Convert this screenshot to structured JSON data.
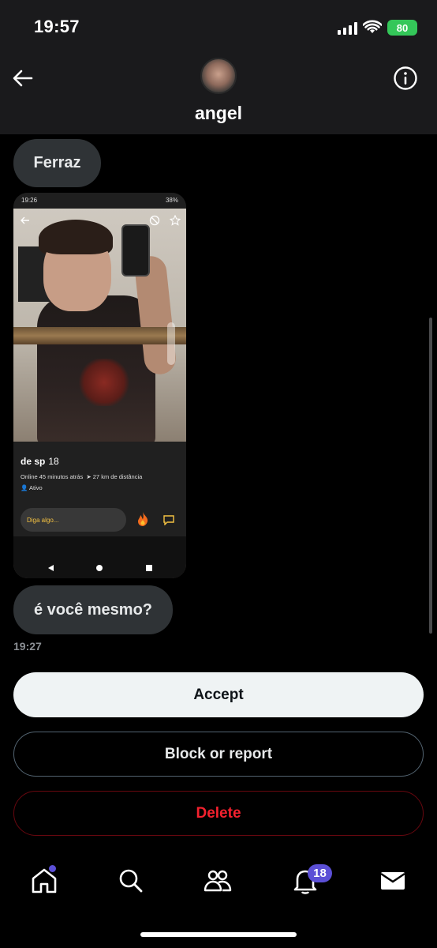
{
  "status_bar": {
    "time": "19:57",
    "battery": "80"
  },
  "header": {
    "name": "angel",
    "back_icon": "back-arrow-icon",
    "info_icon": "info-icon"
  },
  "messages": [
    {
      "text": "Ferraz"
    },
    {
      "type": "image",
      "content": {
        "status_time": "19:26",
        "status_battery": "38%",
        "profile_name": "de sp",
        "profile_age": "18",
        "online_text": "Online 45 minutos atrás",
        "distance_text": "27 km de distância",
        "active_text": "Ativo",
        "compose_placeholder": "Diga algo..."
      }
    },
    {
      "text": "é você mesmo?"
    }
  ],
  "last_timestamp": "19:27",
  "actions": {
    "accept": "Accept",
    "block": "Block or report",
    "delete": "Delete"
  },
  "bottom_nav": {
    "notifications_badge": "18",
    "items": [
      "home-icon",
      "search-icon",
      "communities-icon",
      "notifications-icon",
      "messages-icon"
    ]
  },
  "colors": {
    "accent": "#5b4fd6",
    "delete": "#f4212e",
    "bubble": "#2f3336"
  }
}
